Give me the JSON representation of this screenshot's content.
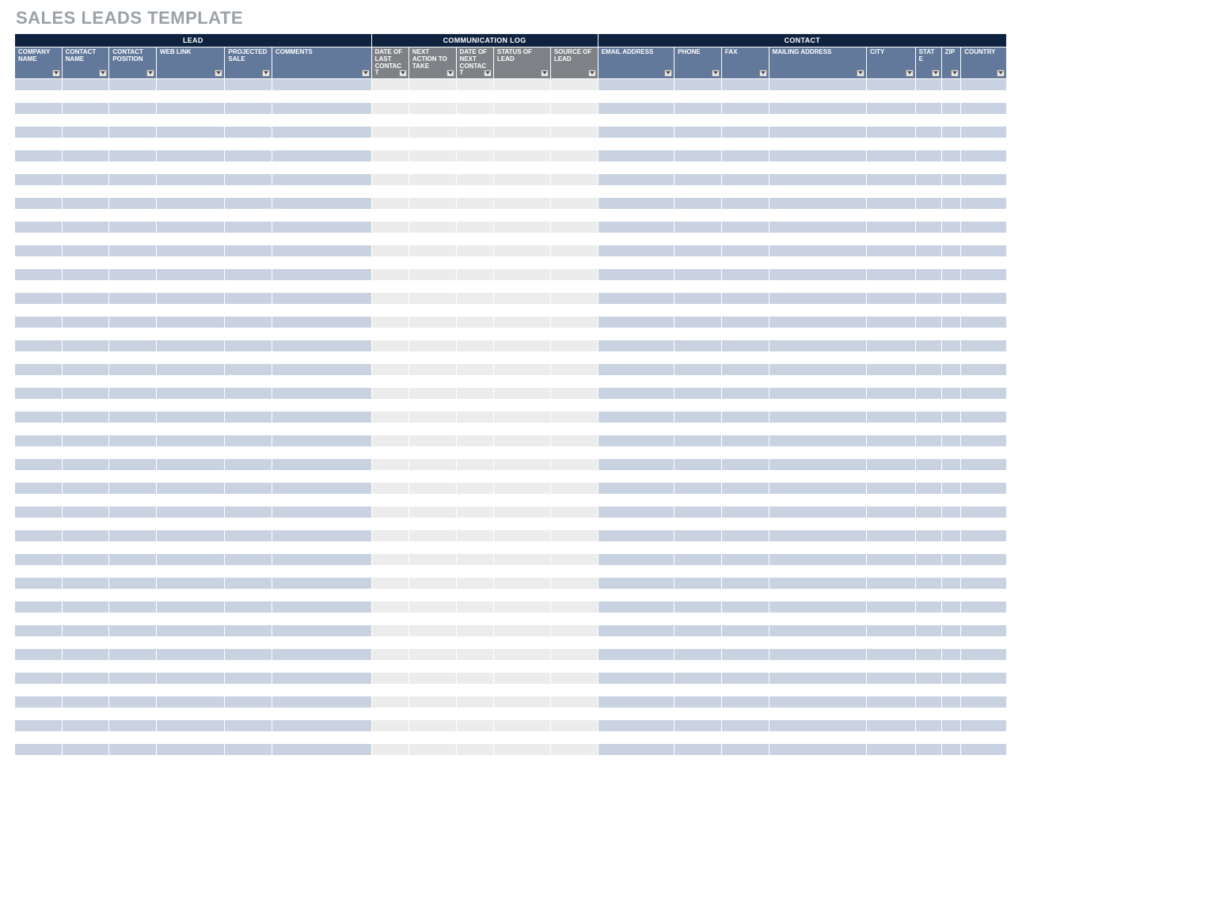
{
  "title": "SALES LEADS TEMPLATE",
  "colors": {
    "group_bar": "#0f2340",
    "lead_header": "#62799c",
    "comm_header": "#7e8287",
    "contact_header": "#62799c",
    "lead_stripe": "#c9d2e0",
    "comm_stripe": "#ececec",
    "contact_stripe": "#c9d2e0"
  },
  "groups": [
    {
      "label": "LEAD",
      "span": 6
    },
    {
      "label": "COMMUNICATION LOG",
      "span": 5
    },
    {
      "label": "CONTACT",
      "span": 8
    }
  ],
  "columns": [
    {
      "label": "COMPANY NAME",
      "group": "lead",
      "class": "c0"
    },
    {
      "label": "CONTACT NAME",
      "group": "lead",
      "class": "c1"
    },
    {
      "label": "CONTACT POSITION",
      "group": "lead",
      "class": "c2"
    },
    {
      "label": "WEB LINK",
      "group": "lead",
      "class": "c3"
    },
    {
      "label": "PROJECTED SALE",
      "group": "lead",
      "class": "c4"
    },
    {
      "label": "COMMENTS",
      "group": "lead",
      "class": "c5"
    },
    {
      "label": "DATE OF LAST CONTACT",
      "group": "comm",
      "class": "c6"
    },
    {
      "label": "NEXT ACTION TO TAKE",
      "group": "comm",
      "class": "c7"
    },
    {
      "label": "DATE OF NEXT CONTACT",
      "group": "comm",
      "class": "c8"
    },
    {
      "label": "STATUS OF LEAD",
      "group": "comm",
      "class": "c9"
    },
    {
      "label": "SOURCE OF LEAD",
      "group": "comm",
      "class": "c10"
    },
    {
      "label": "EMAIL ADDRESS",
      "group": "contact",
      "class": "c11"
    },
    {
      "label": "PHONE",
      "group": "contact",
      "class": "c12"
    },
    {
      "label": "FAX",
      "group": "contact",
      "class": "c13"
    },
    {
      "label": "MAILING ADDRESS",
      "group": "contact",
      "class": "c14"
    },
    {
      "label": "CITY",
      "group": "contact",
      "class": "c15"
    },
    {
      "label": "STATE",
      "group": "contact",
      "class": "c16"
    },
    {
      "label": "ZIP",
      "group": "contact",
      "class": "c17"
    },
    {
      "label": "COUNTRY",
      "group": "contact",
      "class": "c18"
    }
  ],
  "row_count": 58
}
